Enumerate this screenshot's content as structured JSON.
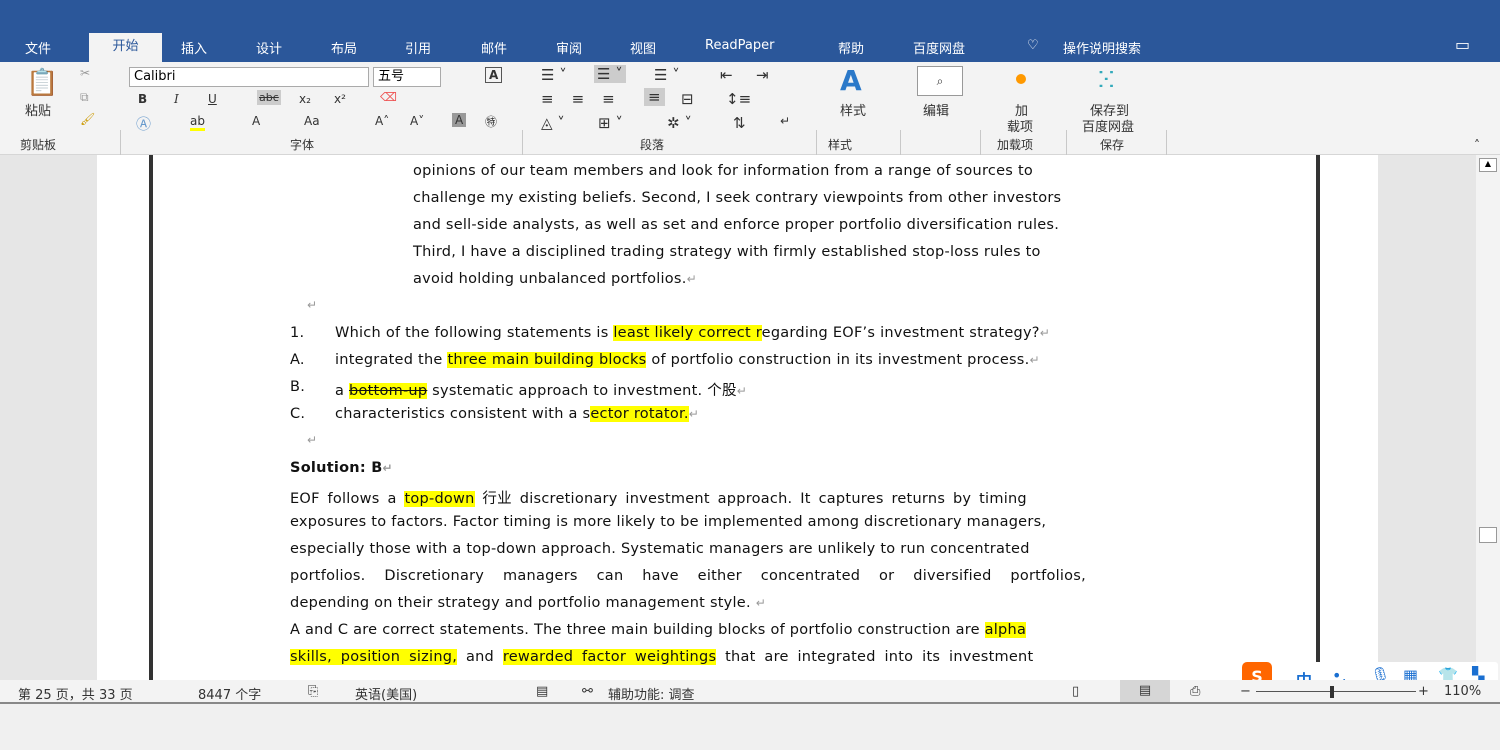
{
  "tabs": [
    "文件",
    "开始",
    "插入",
    "设计",
    "布局",
    "引用",
    "邮件",
    "审阅",
    "视图",
    "ReadPaper",
    "帮助",
    "百度网盘"
  ],
  "tell_me": "操作说明搜索",
  "ribbon": {
    "paste": "粘贴",
    "clipboard": "剪贴板",
    "font_name": "Calibri",
    "font_size": "五号",
    "font_group": "字体",
    "paragraph_group": "段落",
    "styles": "样式",
    "styles_group": "样式",
    "editing": "编辑",
    "addins": "加\n载项",
    "addins_l1": "加",
    "addins_l2": "载项",
    "addins_group": "加载项",
    "save_l1": "保存到",
    "save_l2": "百度网盘",
    "save_group": "保存",
    "bold": "B",
    "italic": "I",
    "underline": "U",
    "strike": "abc",
    "sub": "x₂",
    "sup": "x²",
    "grow": "A˄",
    "shrink": "A˅",
    "case": "Aa"
  },
  "doc": {
    "lines_indented": [
      "opinions of our team members and look for information from a range of sources to",
      "challenge my existing beliefs. Second, I seek contrary viewpoints from other investors",
      "and sell-side analysts, as well as set and enforce proper portfolio diversification rules.",
      "Third, I have a disciplined trading strategy with firmly established stop-loss rules to",
      "avoid holding unbalanced portfolios."
    ],
    "q_num": "1.",
    "q_pre": "Which of the following statements is ",
    "q_hl": "least likely correct r",
    "q_post": "egarding EOF’s investment strategy?",
    "a_label": "A.",
    "a_pre": "integrated the ",
    "a_hl": "three main building blocks",
    "a_post": " of portfolio construction in its investment process.",
    "b_label": "B.",
    "b_pre": "a ",
    "b_hl": "bottom-up",
    "b_post": " systematic approach to investment.   个股",
    "c_label": "C.",
    "c_pre": "characteristics consistent with a s",
    "c_hl": "ector rotator.",
    "solution": "Solution: B",
    "e1_pre": "EOF follows a ",
    "e1_hl": "top-down",
    "e1_post": " 行业 discretionary investment approach. It captures returns by timing",
    "e2": "exposures to factors. Factor timing is more likely to be implemented among discretionary managers,",
    "e3": "especially those with a top-down approach. Systematic managers are unlikely to run concentrated",
    "e4": "portfolios. Discretionary managers can have either concentrated or diversified portfolios,",
    "e5": "depending on their strategy and portfolio management style.",
    "f1_pre": "A and C are correct statements. The three main building blocks of portfolio construction are ",
    "f1_hl": "alpha",
    "f2_hl1": "skills, position sizing,",
    "f2_mid": " and ",
    "f2_hl2": "rewarded factor weightings",
    "f2_post": " that are integrated into its investment"
  },
  "status": {
    "page": "第 25 页，共 33 页",
    "words": "8447 个字",
    "lang": "英语(美国)",
    "access": "辅助功能: 调查",
    "zoom": "110%"
  },
  "ime": {
    "mode": "中"
  },
  "colors": {
    "accent": "#2b579a",
    "highlight": "#ffff00"
  }
}
